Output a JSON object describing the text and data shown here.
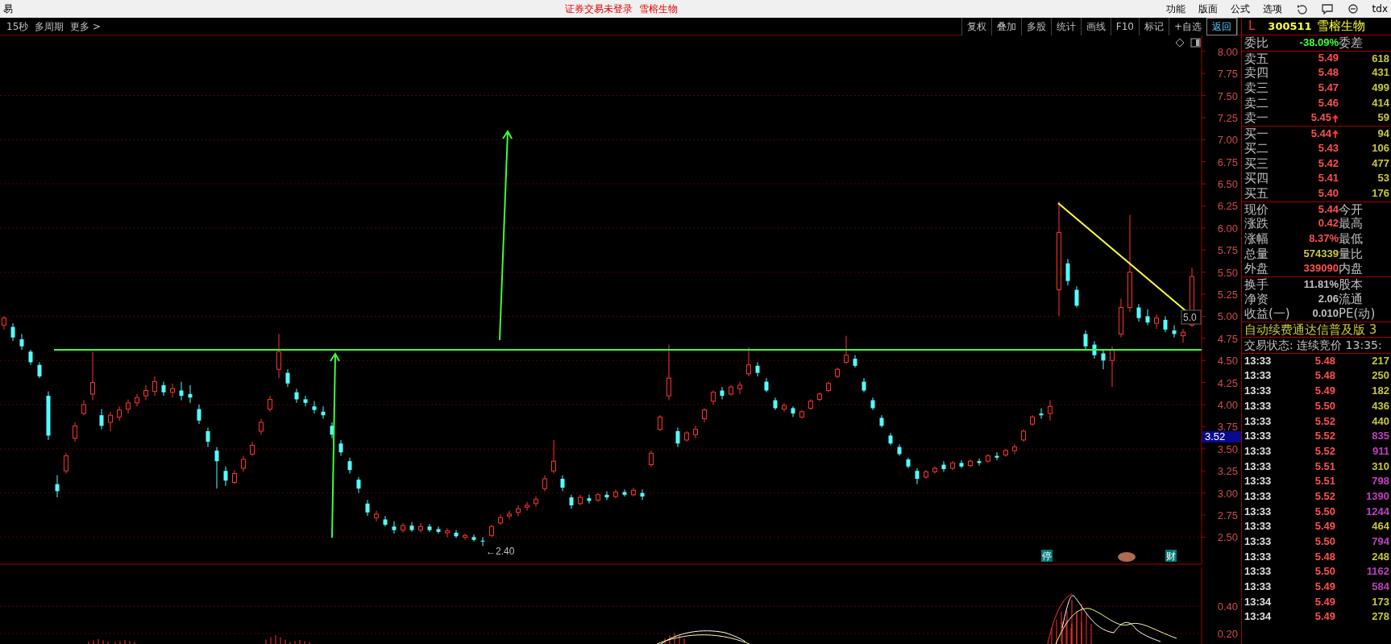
{
  "title_bar": {
    "app_glyph": "易",
    "status": "证券交易未登录",
    "stock": "雪榕生物",
    "menu": [
      "功能",
      "版面",
      "公式",
      "选项"
    ],
    "tail": "tdx"
  },
  "toolbar": {
    "left": [
      "15秒",
      "多周期",
      "更多 >"
    ],
    "buttons": [
      {
        "label": "复权",
        "highlighted": false
      },
      {
        "label": "叠加",
        "highlighted": false
      },
      {
        "label": "多股",
        "highlighted": false
      },
      {
        "label": "统计",
        "highlighted": false
      },
      {
        "label": "画线",
        "highlighted": false
      },
      {
        "label": "F10",
        "highlighted": false
      },
      {
        "label": "标记",
        "highlighted": false
      },
      {
        "label": "+自选",
        "highlighted": false
      },
      {
        "label": "返回",
        "highlighted": true
      }
    ]
  },
  "chart": {
    "chart_data": {
      "type": "candlestick",
      "grid": true,
      "ylim": [
        1.29,
        8.18
      ],
      "ohlc": [
        [
          4.9,
          5.0,
          4.85,
          4.98
        ],
        [
          4.88,
          4.92,
          4.72,
          4.76
        ],
        [
          4.74,
          4.8,
          4.62,
          4.66
        ],
        [
          4.6,
          4.62,
          4.45,
          4.48
        ],
        [
          4.45,
          4.48,
          4.3,
          4.32
        ],
        [
          4.1,
          4.15,
          3.6,
          3.65
        ],
        [
          3.1,
          3.2,
          2.95,
          3.02
        ],
        [
          3.25,
          3.45,
          3.22,
          3.42
        ],
        [
          3.62,
          3.8,
          3.58,
          3.76
        ],
        [
          3.9,
          4.05,
          3.88,
          4.0
        ],
        [
          4.12,
          4.6,
          4.05,
          4.25
        ],
        [
          3.88,
          3.95,
          3.72,
          3.76
        ],
        [
          3.8,
          3.92,
          3.7,
          3.88
        ],
        [
          3.86,
          3.98,
          3.82,
          3.94
        ],
        [
          3.95,
          4.06,
          3.9,
          4.02
        ],
        [
          4.02,
          4.12,
          3.98,
          4.08
        ],
        [
          4.1,
          4.22,
          4.05,
          4.16
        ],
        [
          4.15,
          4.32,
          4.1,
          4.26
        ],
        [
          4.22,
          4.26,
          4.1,
          4.14
        ],
        [
          4.14,
          4.24,
          4.08,
          4.18
        ],
        [
          4.16,
          4.26,
          4.05,
          4.1
        ],
        [
          4.12,
          4.22,
          4.02,
          4.08
        ],
        [
          3.95,
          4.0,
          3.78,
          3.82
        ],
        [
          3.7,
          3.74,
          3.52,
          3.58
        ],
        [
          3.48,
          3.52,
          3.05,
          3.36
        ],
        [
          3.25,
          3.3,
          3.08,
          3.14
        ],
        [
          3.12,
          3.26,
          3.1,
          3.22
        ],
        [
          3.28,
          3.42,
          3.24,
          3.38
        ],
        [
          3.44,
          3.58,
          3.42,
          3.54
        ],
        [
          3.7,
          3.84,
          3.66,
          3.8
        ],
        [
          3.95,
          4.1,
          3.92,
          4.06
        ],
        [
          4.4,
          4.8,
          4.3,
          4.6
        ],
        [
          4.36,
          4.4,
          4.2,
          4.24
        ],
        [
          4.14,
          4.18,
          4.02,
          4.06
        ],
        [
          4.06,
          4.1,
          3.98,
          4.02
        ],
        [
          3.98,
          4.04,
          3.9,
          3.94
        ],
        [
          3.92,
          3.98,
          3.84,
          3.88
        ],
        [
          3.76,
          3.8,
          3.62,
          3.66
        ],
        [
          3.56,
          3.6,
          3.42,
          3.46
        ],
        [
          3.36,
          3.4,
          3.22,
          3.26
        ],
        [
          3.15,
          3.18,
          3.0,
          3.05
        ],
        [
          2.88,
          2.92,
          2.74,
          2.78
        ],
        [
          2.72,
          2.8,
          2.68,
          2.76
        ],
        [
          2.7,
          2.74,
          2.62,
          2.64
        ],
        [
          2.62,
          2.68,
          2.54,
          2.58
        ],
        [
          2.58,
          2.66,
          2.55,
          2.63
        ],
        [
          2.63,
          2.67,
          2.56,
          2.58
        ],
        [
          2.58,
          2.66,
          2.55,
          2.62
        ],
        [
          2.62,
          2.65,
          2.56,
          2.58
        ],
        [
          2.59,
          2.62,
          2.54,
          2.56
        ],
        [
          2.55,
          2.6,
          2.5,
          2.57
        ],
        [
          2.55,
          2.58,
          2.49,
          2.51
        ],
        [
          2.5,
          2.54,
          2.47,
          2.52
        ],
        [
          2.5,
          2.53,
          2.45,
          2.47
        ],
        [
          2.46,
          2.5,
          2.4,
          2.45
        ],
        [
          2.52,
          2.64,
          2.5,
          2.62
        ],
        [
          2.66,
          2.76,
          2.64,
          2.72
        ],
        [
          2.74,
          2.8,
          2.7,
          2.76
        ],
        [
          2.78,
          2.86,
          2.74,
          2.82
        ],
        [
          2.84,
          2.9,
          2.8,
          2.86
        ],
        [
          2.88,
          2.96,
          2.84,
          2.93
        ],
        [
          3.05,
          3.2,
          3.02,
          3.16
        ],
        [
          3.25,
          3.6,
          3.22,
          3.36
        ],
        [
          3.16,
          3.2,
          3.02,
          3.06
        ],
        [
          2.95,
          2.98,
          2.82,
          2.86
        ],
        [
          2.88,
          2.98,
          2.86,
          2.95
        ],
        [
          2.94,
          2.98,
          2.88,
          2.91
        ],
        [
          2.92,
          3.0,
          2.9,
          2.98
        ],
        [
          2.98,
          3.02,
          2.92,
          2.95
        ],
        [
          2.96,
          3.04,
          2.94,
          3.01
        ],
        [
          3.01,
          3.04,
          2.96,
          2.98
        ],
        [
          2.98,
          3.06,
          2.96,
          3.03
        ],
        [
          3.0,
          3.04,
          2.92,
          2.96
        ],
        [
          3.32,
          3.48,
          3.3,
          3.45
        ],
        [
          3.72,
          3.88,
          3.7,
          3.86
        ],
        [
          4.1,
          4.68,
          4.05,
          4.3
        ],
        [
          3.7,
          3.74,
          3.52,
          3.56
        ],
        [
          3.6,
          3.7,
          3.58,
          3.68
        ],
        [
          3.66,
          3.76,
          3.62,
          3.72
        ],
        [
          3.84,
          3.96,
          3.8,
          3.94
        ],
        [
          4.04,
          4.16,
          4.0,
          4.14
        ],
        [
          4.16,
          4.2,
          4.06,
          4.1
        ],
        [
          4.12,
          4.22,
          4.1,
          4.2
        ],
        [
          4.18,
          4.26,
          4.12,
          4.22
        ],
        [
          4.35,
          4.65,
          4.32,
          4.45
        ],
        [
          4.44,
          4.48,
          4.32,
          4.36
        ],
        [
          4.26,
          4.3,
          4.14,
          4.16
        ],
        [
          4.05,
          4.08,
          3.94,
          3.96
        ],
        [
          3.95,
          4.02,
          3.92,
          3.99
        ],
        [
          3.96,
          3.98,
          3.86,
          3.9
        ],
        [
          3.86,
          3.94,
          3.84,
          3.92
        ],
        [
          3.96,
          4.06,
          3.94,
          4.04
        ],
        [
          4.06,
          4.14,
          4.04,
          4.12
        ],
        [
          4.16,
          4.26,
          4.14,
          4.24
        ],
        [
          4.32,
          4.42,
          4.3,
          4.4
        ],
        [
          4.48,
          4.78,
          4.46,
          4.56
        ],
        [
          4.52,
          4.56,
          4.42,
          4.44
        ],
        [
          4.26,
          4.3,
          4.14,
          4.16
        ],
        [
          4.05,
          4.08,
          3.94,
          3.96
        ],
        [
          3.85,
          3.88,
          3.74,
          3.76
        ],
        [
          3.65,
          3.68,
          3.54,
          3.56
        ],
        [
          3.52,
          3.55,
          3.42,
          3.44
        ],
        [
          3.38,
          3.4,
          3.28,
          3.3
        ],
        [
          3.25,
          3.28,
          3.1,
          3.16
        ],
        [
          3.18,
          3.26,
          3.16,
          3.24
        ],
        [
          3.24,
          3.3,
          3.22,
          3.28
        ],
        [
          3.32,
          3.36,
          3.24,
          3.27
        ],
        [
          3.28,
          3.36,
          3.26,
          3.34
        ],
        [
          3.34,
          3.37,
          3.28,
          3.3
        ],
        [
          3.31,
          3.38,
          3.29,
          3.36
        ],
        [
          3.36,
          3.39,
          3.31,
          3.34
        ],
        [
          3.36,
          3.44,
          3.34,
          3.42
        ],
        [
          3.42,
          3.46,
          3.37,
          3.4
        ],
        [
          3.43,
          3.5,
          3.41,
          3.48
        ],
        [
          3.48,
          3.55,
          3.44,
          3.52
        ],
        [
          3.6,
          3.72,
          3.58,
          3.7
        ],
        [
          3.78,
          3.88,
          3.76,
          3.86
        ],
        [
          3.9,
          3.96,
          3.84,
          3.88
        ],
        [
          3.9,
          4.05,
          3.82,
          3.98
        ],
        [
          5.3,
          6.3,
          5.0,
          5.95
        ],
        [
          5.6,
          5.65,
          5.35,
          5.4
        ],
        [
          5.3,
          5.34,
          5.1,
          5.12
        ],
        [
          4.8,
          4.84,
          4.62,
          4.66
        ],
        [
          4.68,
          4.72,
          4.52,
          4.56
        ],
        [
          4.58,
          4.62,
          4.4,
          4.5
        ],
        [
          4.5,
          4.66,
          4.2,
          4.62
        ],
        [
          4.8,
          5.2,
          4.76,
          5.1
        ],
        [
          5.1,
          6.15,
          5.05,
          5.5
        ],
        [
          5.1,
          5.14,
          4.94,
          4.98
        ],
        [
          5.0,
          5.08,
          4.9,
          4.93
        ],
        [
          4.92,
          5.02,
          4.86,
          4.98
        ],
        [
          4.96,
          5.0,
          4.82,
          4.85
        ],
        [
          4.84,
          4.9,
          4.76,
          4.8
        ],
        [
          4.78,
          4.86,
          4.7,
          4.82
        ],
        [
          4.9,
          5.55,
          4.88,
          5.45
        ]
      ],
      "yticks": [
        {
          "value": 8,
          "label": "8.00"
        },
        {
          "value": 7.75,
          "label": "7.75"
        },
        {
          "value": 7.5,
          "label": "7.50"
        },
        {
          "value": 7.25,
          "label": "7.25"
        },
        {
          "value": 7,
          "label": "7.00"
        },
        {
          "value": 6.75,
          "label": "6.75"
        },
        {
          "value": 6.5,
          "label": "6.50"
        },
        {
          "value": 6.25,
          "label": "6.25"
        },
        {
          "value": 6,
          "label": "6.00"
        },
        {
          "value": 5.75,
          "label": "5.75"
        },
        {
          "value": 5.5,
          "label": "5.50"
        },
        {
          "value": 5.25,
          "label": "5.25"
        },
        {
          "value": 5,
          "label": "5.00"
        },
        {
          "value": 4.75,
          "label": "4.75"
        },
        {
          "value": 4.5,
          "label": "4.50"
        },
        {
          "value": 4.25,
          "label": "4.25"
        },
        {
          "value": 4,
          "label": "4.00"
        },
        {
          "value": 3.75,
          "label": "3.75"
        },
        {
          "value": 3.5,
          "label": "3.50"
        },
        {
          "value": 3.25,
          "label": "3.25"
        },
        {
          "value": 3,
          "label": "3.00"
        },
        {
          "value": 2.75,
          "label": "2.75"
        },
        {
          "value": 2.5,
          "label": "2.50"
        }
      ]
    },
    "low_label": "←2.40",
    "last_price_label": "5.0",
    "cursor_price": "3.52",
    "markers": [
      "停",
      "财"
    ],
    "indicator_axis": [
      "0.40",
      "0.20"
    ]
  },
  "quote": {
    "flag": "L",
    "code": "300511",
    "name": "雪榕生物",
    "ratio": {
      "label": "委比",
      "value": "-38.09%",
      "label2": "委差"
    },
    "asks": [
      {
        "label": "卖五",
        "price": "5.49",
        "volume": "618",
        "rising": false
      },
      {
        "label": "卖四",
        "price": "5.48",
        "volume": "431",
        "rising": false
      },
      {
        "label": "卖三",
        "price": "5.47",
        "volume": "499",
        "rising": false
      },
      {
        "label": "卖二",
        "price": "5.46",
        "volume": "414",
        "rising": false
      },
      {
        "label": "卖一",
        "price": "5.45",
        "volume": "59",
        "rising": true
      }
    ],
    "bids": [
      {
        "label": "买一",
        "price": "5.44",
        "volume": "94",
        "rising": true
      },
      {
        "label": "买二",
        "price": "5.43",
        "volume": "106",
        "rising": false
      },
      {
        "label": "买三",
        "price": "5.42",
        "volume": "477",
        "rising": false
      },
      {
        "label": "买四",
        "price": "5.41",
        "volume": "53",
        "rising": false
      },
      {
        "label": "买五",
        "price": "5.40",
        "volume": "176",
        "rising": false
      }
    ],
    "stats": [
      {
        "label": "现价",
        "value": "5.44",
        "label2": "今开",
        "color": "#ff5050"
      },
      {
        "label": "涨跌",
        "value": "0.42",
        "label2": "最高",
        "color": "#ff5050"
      },
      {
        "label": "涨幅",
        "value": "8.37%",
        "label2": "最低",
        "color": "#ff5050"
      },
      {
        "label": "总量",
        "value": "574339",
        "label2": "量比",
        "color": "#c8c83c"
      },
      {
        "label": "外盘",
        "value": "339090",
        "label2": "内盘",
        "color": "#ff5050"
      }
    ],
    "finance": [
      {
        "label": "换手",
        "value": "11.81%",
        "label2": "股本",
        "color": "#c0c0c0"
      },
      {
        "label": "净资",
        "value": "2.06",
        "label2": "流通",
        "color": "#c0c0c0"
      },
      {
        "label": "收益(一)",
        "value": "0.010",
        "label2": "PE(动)",
        "color": "#c0c0c0"
      }
    ],
    "notice": "自动续费通达信普及版 3",
    "trade_status": "交易状态: 连续竞价 13:35:",
    "ticks": [
      {
        "time": "13:33",
        "price": "5.48",
        "volume": "217",
        "color": "#c8c83c"
      },
      {
        "time": "13:33",
        "price": "5.48",
        "volume": "250",
        "color": "#c8c83c"
      },
      {
        "time": "13:33",
        "price": "5.49",
        "volume": "182",
        "color": "#c8c83c"
      },
      {
        "time": "13:33",
        "price": "5.50",
        "volume": "436",
        "color": "#c8c83c"
      },
      {
        "time": "13:33",
        "price": "5.52",
        "volume": "440",
        "color": "#c8c83c"
      },
      {
        "time": "13:33",
        "price": "5.52",
        "volume": "835",
        "color": "#c040c0"
      },
      {
        "time": "13:33",
        "price": "5.52",
        "volume": "911",
        "color": "#c040c0"
      },
      {
        "time": "13:33",
        "price": "5.51",
        "volume": "310",
        "color": "#c8c83c"
      },
      {
        "time": "13:33",
        "price": "5.51",
        "volume": "798",
        "color": "#c040c0"
      },
      {
        "time": "13:33",
        "price": "5.52",
        "volume": "1390",
        "color": "#c040c0"
      },
      {
        "time": "13:33",
        "price": "5.50",
        "volume": "1244",
        "color": "#c040c0"
      },
      {
        "time": "13:33",
        "price": "5.49",
        "volume": "464",
        "color": "#c8c83c"
      },
      {
        "time": "13:33",
        "price": "5.50",
        "volume": "794",
        "color": "#c040c0"
      },
      {
        "time": "13:33",
        "price": "5.48",
        "volume": "248",
        "color": "#c8c83c"
      },
      {
        "time": "13:33",
        "price": "5.50",
        "volume": "1162",
        "color": "#c040c0"
      },
      {
        "time": "13:33",
        "price": "5.49",
        "volume": "584",
        "color": "#c040c0"
      },
      {
        "time": "13:34",
        "price": "5.49",
        "volume": "173",
        "color": "#c8c83c"
      },
      {
        "time": "13:34",
        "price": "5.49",
        "volume": "278",
        "color": "#c8c83c"
      }
    ]
  }
}
